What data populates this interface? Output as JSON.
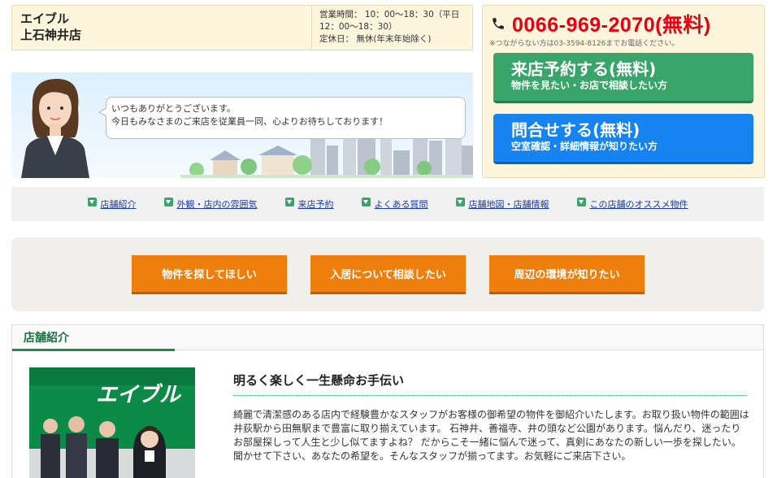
{
  "shop": {
    "brand": "エイブル",
    "branch": "上石神井店",
    "hours_line1": "営業時間： 10：00～18：30（平日",
    "hours_line2": "12：00～18：30）",
    "holiday": "定休日： 無休(年末年始除く)"
  },
  "greeting": {
    "line1": "いつもありがとうございます。",
    "line2": "今日もみなさまのご来店を従業員一同、心よりお待ちしております！"
  },
  "contact": {
    "phone": "0066-969-2070(無料)",
    "note": "※つながらない方は03-3594-8126までお電話ください。",
    "visit_title": "来店予約する(無料)",
    "visit_sub": "物件を見たい・お店で相談したい方",
    "inquiry_title": "問合せする(無料)",
    "inquiry_sub": "空室確認・詳細情報が知りたい方",
    "colors": {
      "phone": "#e60012",
      "visit": "#3aa56a",
      "inquiry": "#1683f0"
    }
  },
  "nav": {
    "items": [
      "店舗紹介",
      "外観・店内の雰囲気",
      "来店予約",
      "よくある質問",
      "店舗地図・店舗情報",
      "この店舗のオススメ物件"
    ]
  },
  "actions": {
    "buttons": [
      "物件を探してほしい",
      "入居について相談したい",
      "周辺の環境が知りたい"
    ],
    "color": "#ef7f0c"
  },
  "section": {
    "title": "店舗紹介",
    "photo_logo": "エイブル",
    "heading": "明るく楽しく一生懸命お手伝い",
    "body": "綺麗で清潔感のある店内で経験豊かなスタッフがお客様の御希望の物件を御紹介いたします。お取り扱い物件の範囲は井荻駅から田無駅まで豊富に取り揃えています。 石神井、善福寺、井の頭など公園があります。悩んだり、迷ったりお部屋探しって人生と少し似てますよね？ だからこそ一緒に悩んで迷って、真剣にあなたの新しい一歩を探したい。聞かせて下さい、あなたの希望を。そんなスタッフが揃ってます。お気軽にご来店下さい。"
  }
}
